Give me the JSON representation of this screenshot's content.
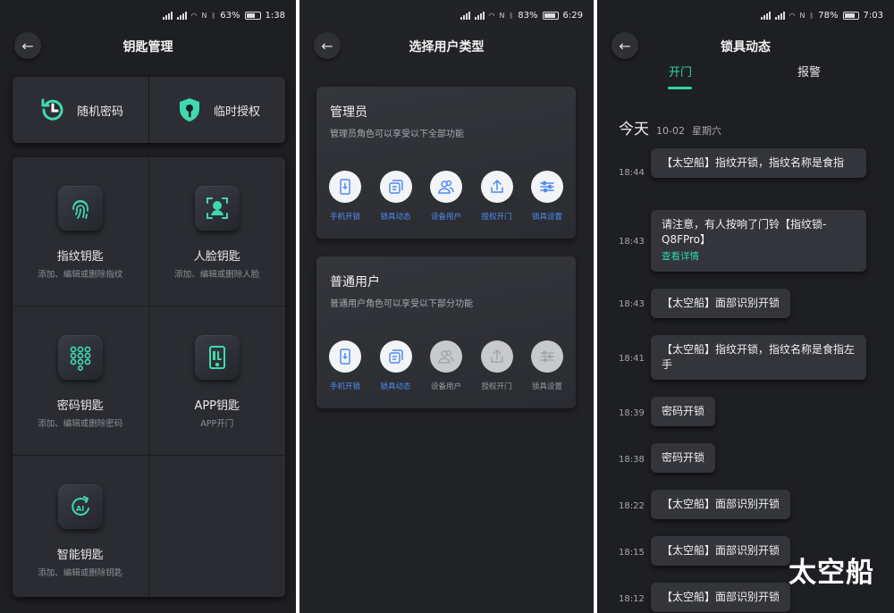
{
  "colors": {
    "accent": "#2fd6a8",
    "blue_label": "#4d8cf5",
    "background": "#1e1f23"
  },
  "panel1": {
    "status": {
      "battery": "63%",
      "time": "1:38"
    },
    "title": "钥匙管理",
    "quick": [
      {
        "label": "随机密码",
        "icon": "clock-refresh-icon"
      },
      {
        "label": "临时授权",
        "icon": "shield-key-icon"
      }
    ],
    "keys": [
      {
        "name": "指纹钥匙",
        "desc": "添加、编辑或删除指纹",
        "icon": "fingerprint-icon"
      },
      {
        "name": "人脸钥匙",
        "desc": "添加、编辑或删除人脸",
        "icon": "face-scan-icon"
      },
      {
        "name": "密码钥匙",
        "desc": "添加、编辑或删除密码",
        "icon": "keypad-icon"
      },
      {
        "name": "APP钥匙",
        "desc": "APP开门",
        "icon": "phone-app-icon"
      },
      {
        "name": "智能钥匙",
        "desc": "添加、编辑或删除钥匙",
        "icon": "ai-key-icon"
      }
    ]
  },
  "panel2": {
    "status": {
      "battery": "83%",
      "time": "6:29"
    },
    "title": "选择用户类型",
    "roles": [
      {
        "name": "管理员",
        "desc": "管理员角色可以享受以下全部功能",
        "features": [
          {
            "label": "手机开锁",
            "enabled": true,
            "icon": "phone-unlock-icon"
          },
          {
            "label": "锁具动态",
            "enabled": true,
            "icon": "activity-icon"
          },
          {
            "label": "设备用户",
            "enabled": true,
            "icon": "users-icon"
          },
          {
            "label": "授权开门",
            "enabled": true,
            "icon": "share-icon"
          },
          {
            "label": "锁具设置",
            "enabled": true,
            "icon": "sliders-icon"
          }
        ]
      },
      {
        "name": "普通用户",
        "desc": "普通用户角色可以享受以下部分功能",
        "features": [
          {
            "label": "手机开锁",
            "enabled": true,
            "icon": "phone-unlock-icon"
          },
          {
            "label": "锁具动态",
            "enabled": true,
            "icon": "activity-icon"
          },
          {
            "label": "设备用户",
            "enabled": false,
            "icon": "users-icon"
          },
          {
            "label": "授权开门",
            "enabled": false,
            "icon": "share-icon"
          },
          {
            "label": "锁具设置",
            "enabled": false,
            "icon": "sliders-icon"
          }
        ]
      }
    ]
  },
  "panel3": {
    "status": {
      "battery": "78%",
      "time": "7:03"
    },
    "title": "锁具动态",
    "tabs": [
      "开门",
      "报警"
    ],
    "day_label": "今天",
    "date": "10-02",
    "weekday": "星期六",
    "events": [
      {
        "time": "18:44",
        "text": "【太空船】指纹开锁，指纹名称是食指"
      },
      {
        "time": "18:43",
        "text": "请注意，有人按响了门铃【指纹锁-Q8FPro】",
        "link": "查看详情"
      },
      {
        "time": "18:43",
        "text": "【太空船】面部识别开锁"
      },
      {
        "time": "18:41",
        "text": "【太空船】指纹开锁，指纹名称是食指左手"
      },
      {
        "time": "18:39",
        "text": "密码开锁"
      },
      {
        "time": "18:38",
        "text": "密码开锁"
      },
      {
        "time": "18:22",
        "text": "【太空船】面部识别开锁"
      },
      {
        "time": "18:15",
        "text": "【太空船】面部识别开锁"
      },
      {
        "time": "18:12",
        "text": "【太空船】面部识别开锁"
      }
    ]
  },
  "watermark": "太空船"
}
